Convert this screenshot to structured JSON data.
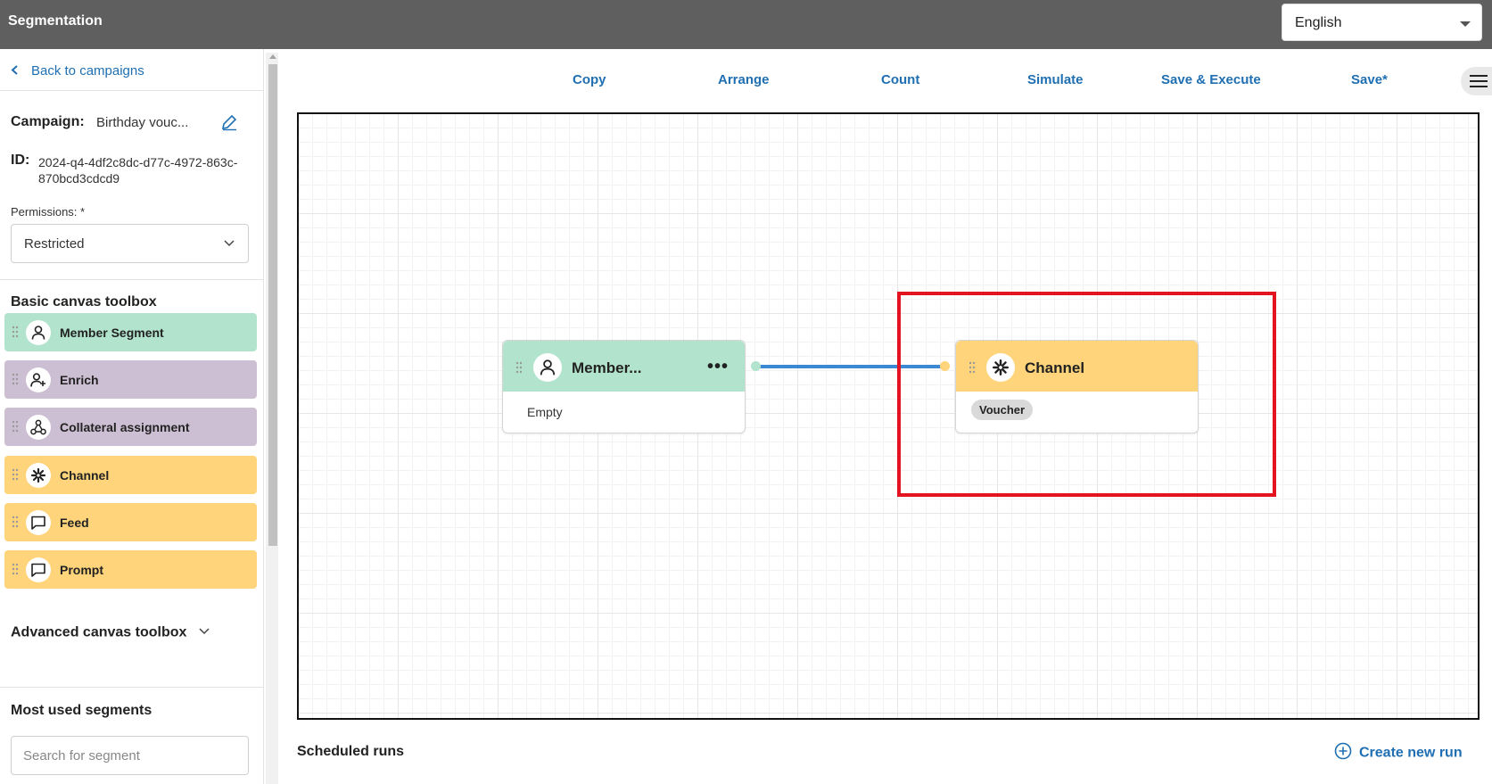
{
  "header": {
    "app_title": "Segmentation",
    "language": "English"
  },
  "sidebar": {
    "back_link": "Back to campaigns",
    "campaign_label": "Campaign:",
    "campaign_name": "Birthday vouc...",
    "id_label": "ID:",
    "id_value": "2024-q4-4df2c8dc-d77c-4972-863c-870bcd3cdcd9",
    "permissions_label": "Permissions: *",
    "permissions_value": "Restricted",
    "basic_toolbox_title": "Basic canvas toolbox",
    "tools": [
      {
        "label": "Member Segment",
        "color": "#b2e4cd",
        "icon": "person-icon"
      },
      {
        "label": "Enrich",
        "color": "#cdbfd3",
        "icon": "person-add-icon"
      },
      {
        "label": "Collateral assignment",
        "color": "#cdbfd3",
        "icon": "hub-icon"
      },
      {
        "label": "Channel",
        "color": "#ffd47a",
        "icon": "asterisk-icon"
      },
      {
        "label": "Feed",
        "color": "#ffd47a",
        "icon": "chat-bubble-icon"
      },
      {
        "label": "Prompt",
        "color": "#ffd47a",
        "icon": "chat-bubble-icon"
      }
    ],
    "advanced_toolbox_title": "Advanced canvas toolbox",
    "most_used_title": "Most used segments",
    "search_placeholder": "Search for segment"
  },
  "toolbar": {
    "copy": "Copy",
    "arrange": "Arrange",
    "count": "Count",
    "simulate": "Simulate",
    "save_execute": "Save & Execute",
    "save": "Save*"
  },
  "canvas": {
    "nodes": [
      {
        "title": "Member...",
        "body": "Empty",
        "color": "#b2e4cd",
        "icon": "person-icon"
      },
      {
        "title": "Channel",
        "tag": "Voucher",
        "color": "#ffd47a",
        "icon": "asterisk-icon"
      }
    ],
    "connector_color": "#3b88d4",
    "highlight_color": "#e3141f"
  },
  "footer": {
    "scheduled_runs": "Scheduled runs",
    "create_new_run": "Create new run"
  },
  "colors": {
    "accent": "#1f6fb2",
    "topbar": "#5f5f5f"
  }
}
